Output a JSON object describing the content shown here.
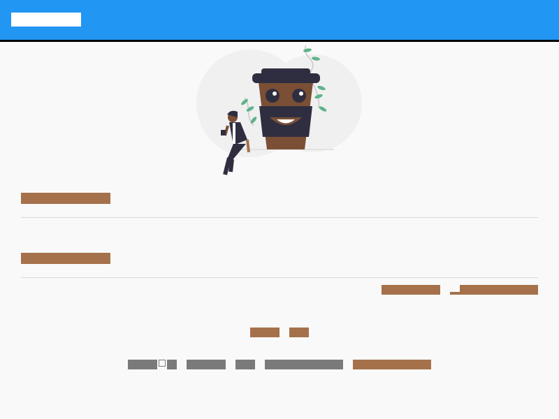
{
  "header": {
    "brand_text": "",
    "color": "#2196f3"
  },
  "illustration": {
    "name": "coffee-cup-mascot-illustration"
  },
  "sections": [
    {
      "heading": ""
    },
    {
      "heading": ""
    }
  ],
  "actions": {
    "left_label": "",
    "right_label": ""
  },
  "pagination": {
    "prev_label": "",
    "next_label": ""
  },
  "footer": {
    "items": [
      "",
      "",
      "",
      ""
    ],
    "link": ""
  },
  "colors": {
    "accent": "#a5714b",
    "text_muted": "#7a7a7a",
    "background": "#f9f9f9"
  }
}
